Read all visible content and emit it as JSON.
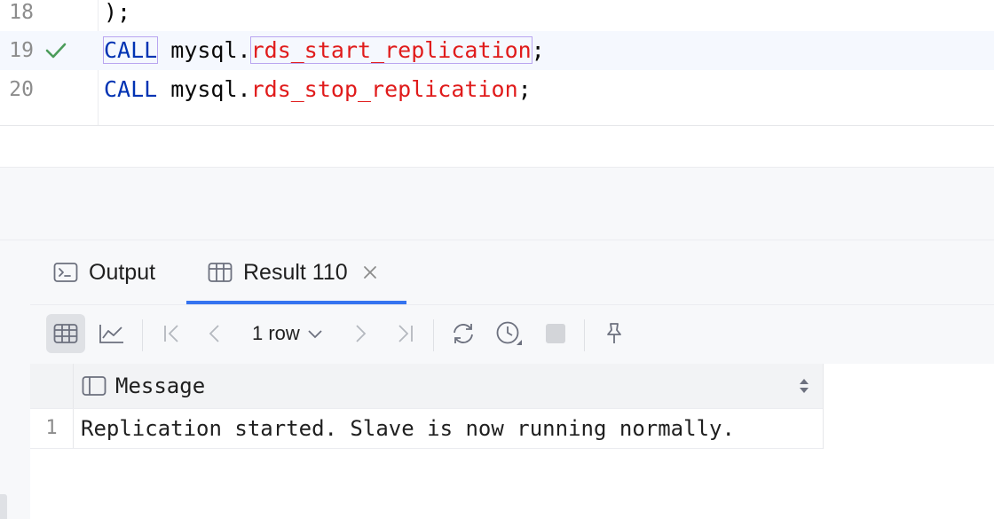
{
  "editor": {
    "lines": [
      {
        "number": "18",
        "code_tail": ");"
      },
      {
        "number": "19",
        "status": "check-icon",
        "keyword": "CALL",
        "schema": "mysql.",
        "function": "rds_start_replication",
        "end": ";"
      },
      {
        "number": "20",
        "keyword": "CALL",
        "schema": "mysql.",
        "function": "rds_stop_replication",
        "end": ";"
      }
    ]
  },
  "tool_window": {
    "tabs": [
      {
        "label": "Output",
        "icon": "console-icon"
      },
      {
        "label": "Result 110",
        "icon": "table-icon",
        "active": true,
        "closable": true
      }
    ],
    "toolbar": {
      "rows_label": "1 row",
      "buttons": [
        "table-view-icon",
        "chart-view-icon",
        "first-page-icon",
        "previous-page-icon",
        "next-page-icon",
        "last-page-icon",
        "refresh-icon",
        "history-icon",
        "stop-icon",
        "pin-icon"
      ]
    },
    "grid": {
      "columns": [
        "Message"
      ],
      "rows": [
        {
          "num": "1",
          "cells": [
            "Replication started. Slave is now running normally."
          ]
        }
      ]
    }
  },
  "colors": {
    "keyword": "#0033b3",
    "function": "#e01b1b",
    "check": "#4b9c5a",
    "accent": "#3574f0"
  }
}
